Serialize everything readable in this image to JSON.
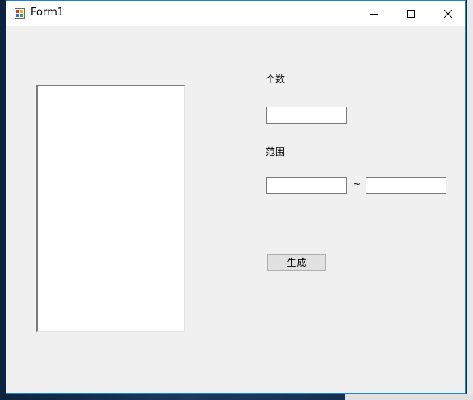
{
  "window": {
    "title": "Form1",
    "minimize_label": "Minimize",
    "maximize_label": "Maximize",
    "close_label": "Close"
  },
  "form": {
    "count_label": "个数",
    "count_value": "",
    "range_label": "范围",
    "range_min_value": "",
    "range_separator": "~",
    "range_max_value": "",
    "generate_button": "生成",
    "listbox_items": []
  },
  "colors": {
    "window_border": "#1883d7",
    "client_background": "#f0f0f0",
    "button_background": "#e1e1e1"
  }
}
